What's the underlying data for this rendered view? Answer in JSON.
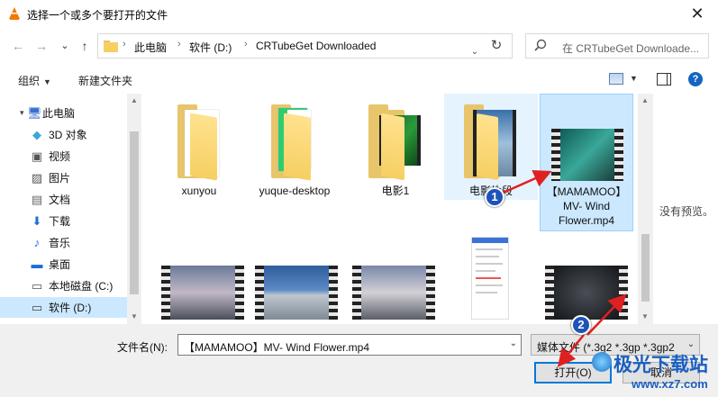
{
  "window": {
    "title": "选择一个或多个要打开的文件",
    "close": "✕"
  },
  "nav": {
    "back": "←",
    "forward": "→",
    "recent": "⌄",
    "up": "↑",
    "breadcrumb": [
      "此电脑",
      "软件 (D:)",
      "CRTubeGet Downloaded"
    ],
    "separator": "›",
    "refresh": "↻",
    "search_placeholder": "在 CRTubeGet Downloade..."
  },
  "toolbar": {
    "organize": "组织",
    "new_folder": "新建文件夹",
    "help": "?"
  },
  "sidebar": {
    "items": [
      {
        "label": "此电脑",
        "icon": "computer-icon",
        "glyph": "🖥"
      },
      {
        "label": "3D 对象",
        "icon": "3d-objects-icon",
        "glyph": "◆"
      },
      {
        "label": "视频",
        "icon": "video-folder-icon",
        "glyph": "▣"
      },
      {
        "label": "图片",
        "icon": "pictures-folder-icon",
        "glyph": "▨"
      },
      {
        "label": "文档",
        "icon": "documents-folder-icon",
        "glyph": "▤"
      },
      {
        "label": "下载",
        "icon": "downloads-folder-icon",
        "glyph": "⬇"
      },
      {
        "label": "音乐",
        "icon": "music-folder-icon",
        "glyph": "♪"
      },
      {
        "label": "桌面",
        "icon": "desktop-folder-icon",
        "glyph": "▬"
      },
      {
        "label": "本地磁盘 (C:)",
        "icon": "local-disk-icon",
        "glyph": "▭"
      },
      {
        "label": "软件 (D:)",
        "icon": "drive-icon",
        "glyph": "▭"
      }
    ],
    "selected_index": 9
  },
  "files": [
    {
      "name": "xunyou",
      "kind": "folder"
    },
    {
      "name": "yuque-desktop",
      "kind": "folder"
    },
    {
      "name": "电影1",
      "kind": "folder"
    },
    {
      "name": "电影片段",
      "kind": "folder"
    },
    {
      "name": "【MAMAMOO】MV- Wind Flower.mp4",
      "kind": "video"
    },
    {
      "name": "",
      "kind": "video"
    },
    {
      "name": "",
      "kind": "video"
    },
    {
      "name": "",
      "kind": "video"
    },
    {
      "name": "",
      "kind": "image"
    },
    {
      "name": "",
      "kind": "video"
    }
  ],
  "preview": {
    "text": "没有预览。"
  },
  "footer": {
    "filename_label": "文件名(N):",
    "filename_value": "【MAMAMOO】MV- Wind Flower.mp4",
    "filetype_value": "媒体文件 (*.3g2 *.3gp *.3gp2",
    "open_button": "打开(O)",
    "cancel_button": "取消"
  },
  "annotations": {
    "marker1": "1",
    "marker2": "2",
    "arrow_color": "#e02020"
  },
  "watermark": {
    "title": "极光下载站",
    "url": "www.xz7.com"
  },
  "colors": {
    "selection": "#cce8ff",
    "accent": "#0078d7",
    "folder": "#f6cf62"
  }
}
